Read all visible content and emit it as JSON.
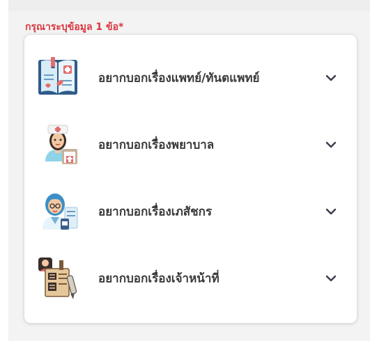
{
  "question": {
    "required_label": "กรุณาระบุข้อมูล 1 ข้อ*"
  },
  "options": [
    {
      "label": "อยากบอกเรื่องแพทย์/ทันตแพทย์",
      "icon": "medical-book-icon"
    },
    {
      "label": "อยากบอกเรื่องพยาบาล",
      "icon": "nurse-icon"
    },
    {
      "label": "อยากบอกเรื่องเภสัชกร",
      "icon": "pharmacist-icon"
    },
    {
      "label": "อยากบอกเรื่องเจ้าหน้าที่",
      "icon": "staff-documents-icon"
    }
  ],
  "colors": {
    "required_text": "#d9363e",
    "label_text": "#3a3a3a",
    "chevron": "#3a3a4a"
  }
}
